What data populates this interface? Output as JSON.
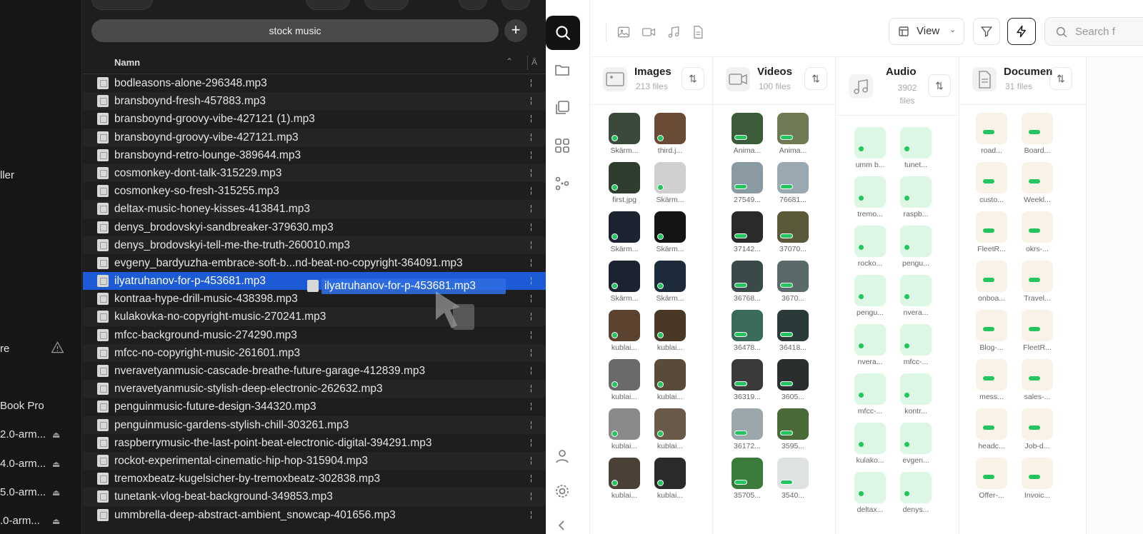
{
  "finder": {
    "search_text": "stock music",
    "add_label": "+",
    "column_name": "Namn",
    "sidebar": [
      {
        "label": "ller",
        "eject": false,
        "warn": false
      },
      {
        "label": "re",
        "eject": false,
        "warn": true
      },
      {
        "label": "Book Pro",
        "eject": false,
        "warn": false
      },
      {
        "label": "2.0-arm...",
        "eject": true,
        "warn": false
      },
      {
        "label": "4.0-arm...",
        "eject": true,
        "warn": false
      },
      {
        "label": "5.0-arm...",
        "eject": true,
        "warn": false
      },
      {
        "label": ".0-arm...",
        "eject": true,
        "warn": false
      }
    ],
    "files": [
      "bodleasons-alone-296348.mp3",
      "bransboynd-fresh-457883.mp3",
      "bransboynd-groovy-vibe-427121 (1).mp3",
      "bransboynd-groovy-vibe-427121.mp3",
      "bransboynd-retro-lounge-389644.mp3",
      "cosmonkey-dont-talk-315229.mp3",
      "cosmonkey-so-fresh-315255.mp3",
      "deltax-music-honey-kisses-413841.mp3",
      "denys_brodovskyi-sandbreaker-379630.mp3",
      "denys_brodovskyi-tell-me-the-truth-260010.mp3",
      "evgeny_bardyuzha-embrace-soft-b...nd-beat-no-copyright-364091.mp3",
      "ilyatruhanov-for-p-453681.mp3",
      "kontraa-hype-drill-music-438398.mp3",
      "kulakovka-no-copyright-music-270241.mp3",
      "mfcc-background-music-274290.mp3",
      "mfcc-no-copyright-music-261601.mp3",
      "nveravetyanmusic-cascade-breathe-future-garage-412839.mp3",
      "nveravetyanmusic-stylish-deep-electronic-262632.mp3",
      "penguinmusic-future-design-344320.mp3",
      "penguinmusic-gardens-stylish-chill-303261.mp3",
      "raspberrymusic-the-last-point-beat-electronic-digital-394291.mp3",
      "rockot-experimental-cinematic-hip-hop-315904.mp3",
      "tremoxbeatz-kugelsicher-by-tremoxbeatz-302838.mp3",
      "tunetank-vlog-beat-background-349853.mp3",
      "ummbrella-deep-abstract-ambient_snowcap-401656.mp3"
    ],
    "selected_index": 11,
    "drag_label": "ilyatruhanov-for-p-453681.mp3"
  },
  "app": {
    "view_label": "View",
    "search_placeholder": "Search f",
    "columns": [
      {
        "title": "Images",
        "count": "213 files",
        "kind": "image",
        "labels": [
          "Skärm...",
          "third.j...",
          "first.jpg",
          "Skärm...",
          "Skärm...",
          "Skärm...",
          "Skärm...",
          "Skärm...",
          "kublai...",
          "kublai...",
          "kublai...",
          "kublai...",
          "kublai...",
          "kublai...",
          "kublai...",
          "kublai..."
        ]
      },
      {
        "title": "Videos",
        "count": "100 files",
        "kind": "video",
        "labels": [
          "Anima...",
          "Anima...",
          "27549...",
          "76681...",
          "37142...",
          "37070...",
          "36768...",
          "3670...",
          "36478...",
          "36418...",
          "36319...",
          "3605...",
          "36172...",
          "3595...",
          "35705...",
          "3540..."
        ]
      },
      {
        "title": "Audio",
        "count": "3902 files",
        "kind": "audio",
        "labels": [
          "umm b...",
          "tunet...",
          "tremo...",
          "raspb...",
          "rocko...",
          "pengu...",
          "pengu...",
          "nvera...",
          "nvera...",
          "mfcc-...",
          "mfcc-...",
          "kontr...",
          "kulako...",
          "evgen...",
          "deltax...",
          "denys..."
        ]
      },
      {
        "title": "Documen",
        "count": "31 files",
        "kind": "doc",
        "labels": [
          "road...",
          "Board...",
          "custo...",
          "Weekl...",
          "FleetR...",
          "okrs-...",
          "onboa...",
          "Travel...",
          "Blog-...",
          "FleetR...",
          "mess...",
          "sales-...",
          "headc...",
          "Job-d...",
          "Offer-...",
          "Invoic..."
        ]
      }
    ]
  }
}
